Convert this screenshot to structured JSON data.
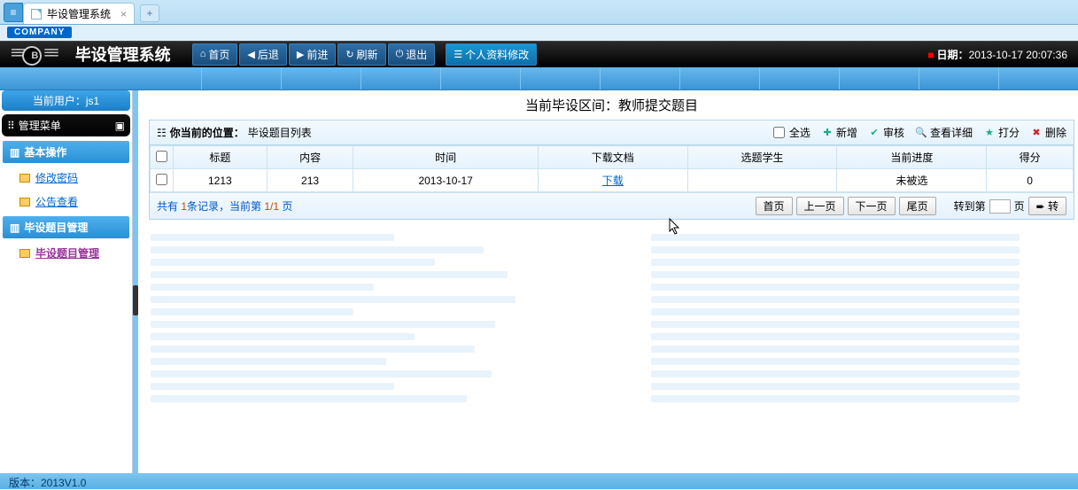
{
  "window": {
    "tab_title": "毕设管理系统"
  },
  "company_tag": "COMPANY",
  "app_title": "毕设管理系统",
  "nav": {
    "home": "首页",
    "back": "后退",
    "forward": "前进",
    "refresh": "刷新",
    "exit": "退出",
    "profile": "个人资料修改"
  },
  "date_label": "日期：",
  "date_value": "2013-10-17 20:07:36",
  "sidebar": {
    "current_user_label": "当前用户：",
    "current_user": "js1",
    "menu_title": "管理菜单",
    "sections": [
      {
        "title": "基本操作",
        "items": [
          {
            "label": "修改密码"
          },
          {
            "label": "公告查看"
          }
        ]
      },
      {
        "title": "毕设题目管理",
        "items": [
          {
            "label": "毕设题目管理"
          }
        ]
      }
    ]
  },
  "main": {
    "page_heading": "当前毕设区间：教师提交题目",
    "crumb_label": "你当前的位置：",
    "crumb_value": "毕设题目列表",
    "actions": {
      "select_all": "全选",
      "add": "新增",
      "audit": "审核",
      "detail": "查看详细",
      "score": "打分",
      "delete": "删除"
    },
    "columns": [
      "",
      "标题",
      "内容",
      "时间",
      "下载文档",
      "选题学生",
      "当前进度",
      "得分"
    ],
    "rows": [
      {
        "title": "1213",
        "content": "213",
        "time": "2013-10-17",
        "download": "下载",
        "student": "",
        "progress": "未被选",
        "score": "0"
      }
    ],
    "pager": {
      "text_prefix": "共有 ",
      "count": "1",
      "text_mid": "条记录，当前第 ",
      "page": "1/1",
      "text_suffix": " 页",
      "first": "首页",
      "prev": "上一页",
      "next": "下一页",
      "last": "尾页",
      "goto_label": "转到第",
      "page_unit": "页",
      "go": "➨ 转"
    }
  },
  "footer_version": "版本：2013V1.0"
}
